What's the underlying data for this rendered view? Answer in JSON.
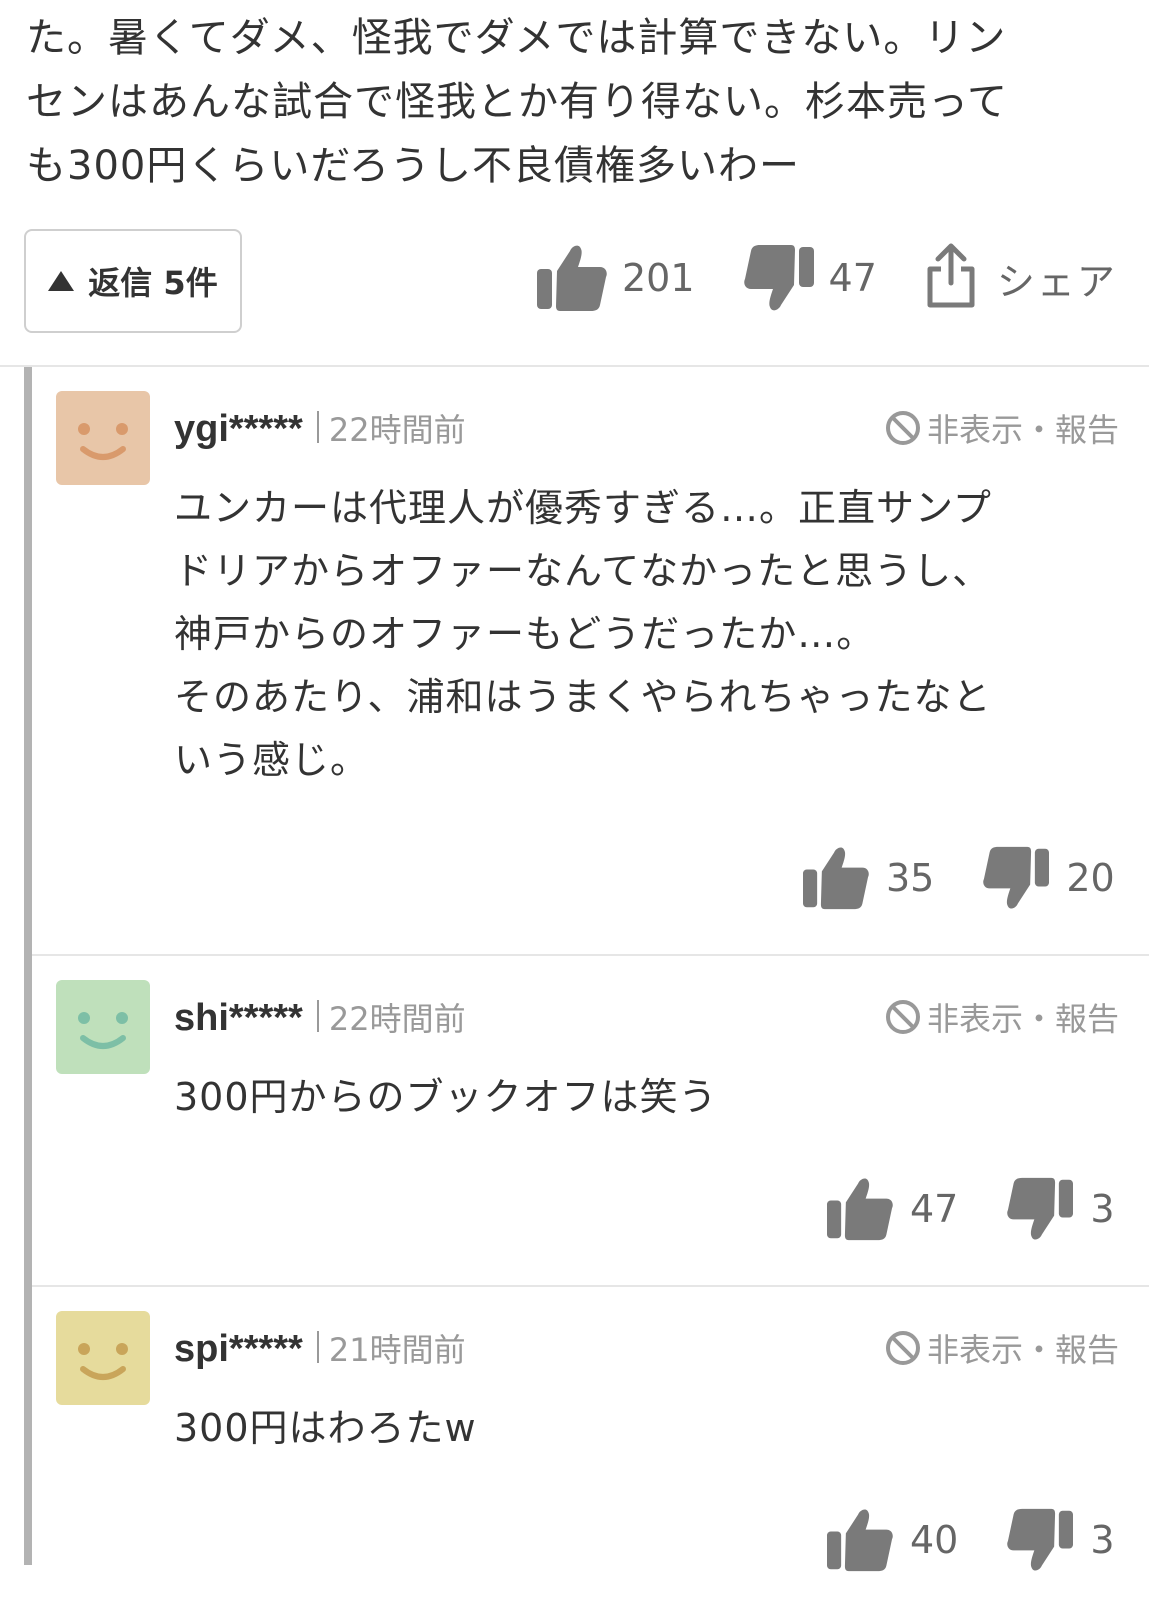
{
  "main_comment": {
    "text_lines": [
      "た。暑くてダメ、怪我でダメでは計算できない。リン",
      "センはあんな試合で怪我とか有り得ない。杉本売って",
      "も300円くらいだろうし不良債権多いわー"
    ],
    "replies_label": "返信 5件",
    "likes": "201",
    "dislikes": "47",
    "share_label": "シェア"
  },
  "replies": [
    {
      "username": "ygi*****",
      "time": "22時間前",
      "hide_report": "非表示・報告",
      "avatar_color": "#e8c6a8",
      "avatar_face_color": "#d99a6c",
      "text_lines": [
        "ユンカーは代理人が優秀すぎる…。正直サンプ",
        "ドリアからオファーなんてなかったと思うし、",
        "神戸からのオファーもどうだったか…。",
        "そのあたり、浦和はうまくやられちゃったなと",
        "いう感じ。"
      ],
      "likes": "35",
      "dislikes": "20"
    },
    {
      "username": "shi*****",
      "time": "22時間前",
      "hide_report": "非表示・報告",
      "avatar_color": "#bfe0bb",
      "avatar_face_color": "#7dbfa6",
      "text_lines": [
        "300円からのブックオフは笑う"
      ],
      "likes": "47",
      "dislikes": "3"
    },
    {
      "username": "spi*****",
      "time": "21時間前",
      "hide_report": "非表示・報告",
      "avatar_color": "#e6db9c",
      "avatar_face_color": "#c9a55a",
      "text_lines": [
        "300円はわろたw"
      ],
      "likes": "40",
      "dislikes": "3"
    }
  ]
}
